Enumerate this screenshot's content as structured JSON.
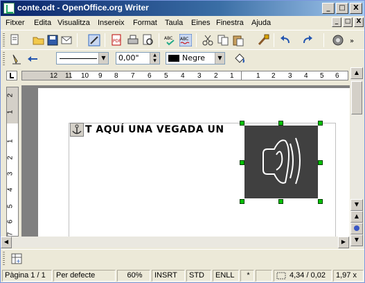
{
  "window": {
    "title": "conte.odt - OpenOffice.org Writer"
  },
  "title_buttons": {
    "minimize": "_",
    "maximize": "□",
    "close": "X"
  },
  "menu": [
    "Fitxer",
    "Edita",
    "Visualitza",
    "Insereix",
    "Format",
    "Taula",
    "Eines",
    "Finestra",
    "Ajuda"
  ],
  "toolbar2": {
    "line_width": "0,00\"",
    "line_color": "Negre"
  },
  "ruler": {
    "h_ticks": [
      "12",
      "11",
      "10",
      "9",
      "8",
      "7",
      "6",
      "5",
      "4",
      "3",
      "2",
      "1",
      "1",
      "2",
      "3",
      "4",
      "5",
      "6"
    ],
    "v_ticks": [
      "2",
      "1",
      "1",
      "2",
      "3",
      "4",
      "5",
      "6",
      "7"
    ]
  },
  "document": {
    "text": "T AQUÍ UNA VEGADA UN"
  },
  "status": {
    "page": "Pàgina  1 / 1",
    "style": "Per defecte",
    "zoom": "60%",
    "insert": "INSRT",
    "std": "STD",
    "enll": "ENLL",
    "modified": "*",
    "position": "4,34 / 0,02",
    "size": "1,97 x"
  },
  "colors": {
    "handle": "#00c000",
    "image_bg": "#404040",
    "title_start": "#0a246a"
  }
}
